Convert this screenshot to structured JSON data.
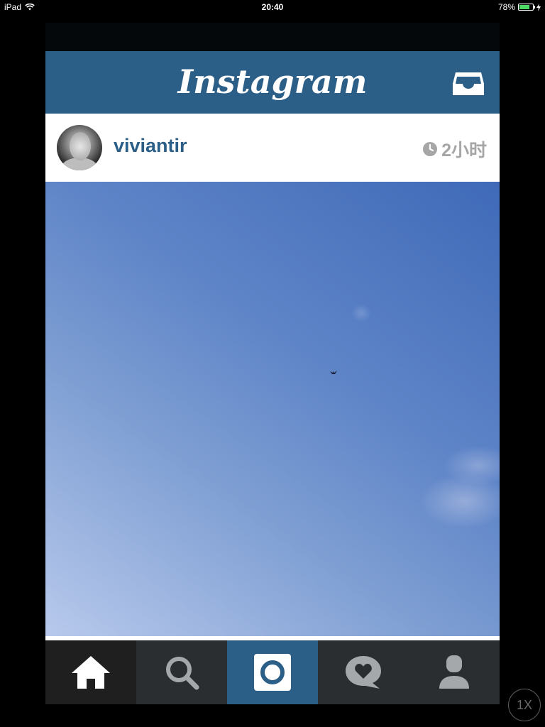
{
  "status_bar": {
    "device": "iPad",
    "time": "20:40",
    "battery": "78%",
    "battery_level": 0.78
  },
  "header": {
    "logo": "Instagram",
    "inbox_icon": "inbox-tray-icon"
  },
  "post": {
    "username": "viviantir",
    "time_ago": "2小时",
    "time_icon": "clock-icon"
  },
  "tab_bar": {
    "tabs": [
      {
        "id": "home",
        "icon": "home-icon",
        "active": true
      },
      {
        "id": "explore",
        "icon": "search-icon"
      },
      {
        "id": "camera",
        "icon": "camera-icon"
      },
      {
        "id": "news",
        "icon": "heart-speech-bubble-icon"
      },
      {
        "id": "profile",
        "icon": "person-icon"
      }
    ]
  },
  "zoom_button": {
    "label": "1X"
  },
  "colors": {
    "brand": "#2c5f88",
    "muted_text": "#a6a6a6",
    "tab_icon": "#a4a8ab"
  }
}
